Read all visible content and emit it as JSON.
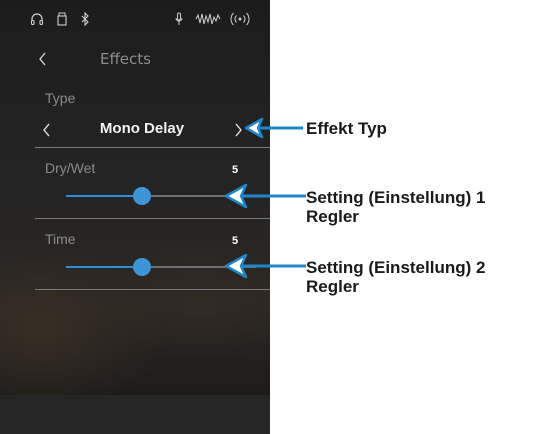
{
  "status_bar": {
    "icons": [
      "headphones-icon",
      "usb-icon",
      "bluetooth-icon",
      "microphone-icon",
      "audio-wave-icon",
      "wireless-icon"
    ]
  },
  "header": {
    "title": "Effects",
    "back_icon": "chevron-left-icon"
  },
  "type": {
    "label": "Type",
    "value": "Mono Delay"
  },
  "sliders": [
    {
      "label": "Dry/Wet",
      "value": "5",
      "level": 0.4
    },
    {
      "label": "Time",
      "value": "5",
      "level": 0.4
    }
  ],
  "accent_color": "#3d95d8",
  "callouts": [
    {
      "text": "Effekt Typ"
    },
    {
      "text": "Setting (Einstellung) 1\nRegler"
    },
    {
      "text": "Setting (Einstellung) 2\nRegler"
    }
  ]
}
